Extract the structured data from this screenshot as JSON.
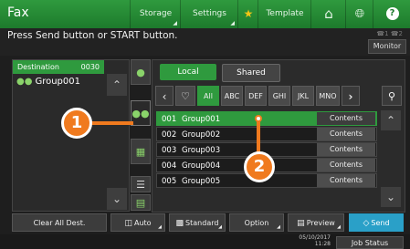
{
  "header": {
    "title": "Fax",
    "storage_label": "Storage",
    "settings_label": "Settings",
    "template_label": "Template"
  },
  "message": {
    "text": "Press Send button or START button.",
    "lines_indicator": "☎1 ☎2",
    "monitor_label": "Monitor"
  },
  "destination": {
    "header_label": "Destination",
    "count": "0030",
    "items": [
      {
        "label": "Group001"
      }
    ]
  },
  "main": {
    "tab_local": "Local",
    "tab_shared": "Shared",
    "filters": [
      "All",
      "ABC",
      "DEF",
      "GHI",
      "JKL",
      "MNO"
    ],
    "selected_filter": "All",
    "rows": [
      {
        "num": "001",
        "name": "Group001",
        "button": "Contents",
        "selected": true
      },
      {
        "num": "002",
        "name": "Group002",
        "button": "Contents",
        "selected": false
      },
      {
        "num": "003",
        "name": "Group003",
        "button": "Contents",
        "selected": false
      },
      {
        "num": "004",
        "name": "Group004",
        "button": "Contents",
        "selected": false
      },
      {
        "num": "005",
        "name": "Group005",
        "button": "Contents",
        "selected": false
      }
    ]
  },
  "bottom": {
    "clear_label": "Clear All Dest.",
    "auto_label": "Auto",
    "standard_label": "Standard",
    "option_label": "Option",
    "preview_label": "Preview",
    "send_label": "Send"
  },
  "status": {
    "date": "05/10/2017",
    "time": "11:28",
    "job_status_label": "Job Status"
  },
  "callouts": {
    "one": "1",
    "two": "2"
  },
  "colors": {
    "accent": "#2f9a3e",
    "send": "#2aa0c8",
    "callout": "#f07a1e"
  }
}
